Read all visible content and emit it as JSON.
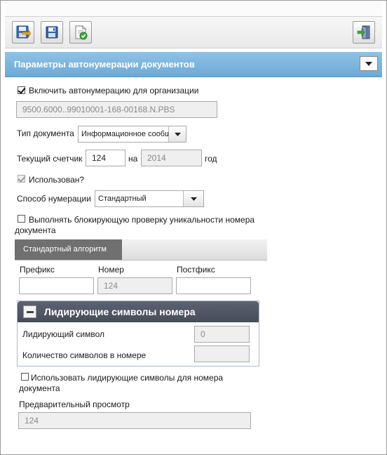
{
  "toolbar": {
    "buttons": [
      {
        "icon": "save-and-exit-icon"
      },
      {
        "icon": "save-icon"
      },
      {
        "icon": "apply-icon"
      },
      {
        "icon": "exit-icon"
      }
    ]
  },
  "panel": {
    "title": "Параметры автонумерации документов"
  },
  "form": {
    "enable_autonumbering": {
      "label": "Включить автонумерацию для организации",
      "checked": true
    },
    "org_code": "9500.6000..99010001-168-00168.N.PBS",
    "doc_type": {
      "label": "Тип документа",
      "value": "Информационное сообщ"
    },
    "counter": {
      "label": "Текущий счетчик",
      "value": "124",
      "on_label": "на",
      "year": "2014",
      "year_label": "год"
    },
    "used": {
      "label": "Использован?",
      "checked": true
    },
    "numbering_method": {
      "label": "Способ нумерации",
      "value": "Стандартный"
    },
    "unique_check": {
      "label_line1": "Выполнять блокирующую проверку уникальности номера",
      "label_line2": "документа",
      "checked": false
    }
  },
  "tabs": [
    {
      "label": "Стандартный алгоритм"
    }
  ],
  "algorithm": {
    "prefix": {
      "label": "Префикс",
      "value": ""
    },
    "number": {
      "label": "Номер",
      "value": "124"
    },
    "postfix": {
      "label": "Постфикс",
      "value": ""
    }
  },
  "leading": {
    "title": "Лидирующие символы номера",
    "symbol": {
      "label": "Лидирующий символ",
      "value": "0"
    },
    "count": {
      "label": "Количество символов в номере",
      "value": ""
    }
  },
  "use_leading": {
    "label_line1": "Использовать лидирующие символы для номера",
    "label_line2": "документа",
    "checked": false
  },
  "preview": {
    "label": "Предварительный просмотр",
    "value": "124"
  }
}
